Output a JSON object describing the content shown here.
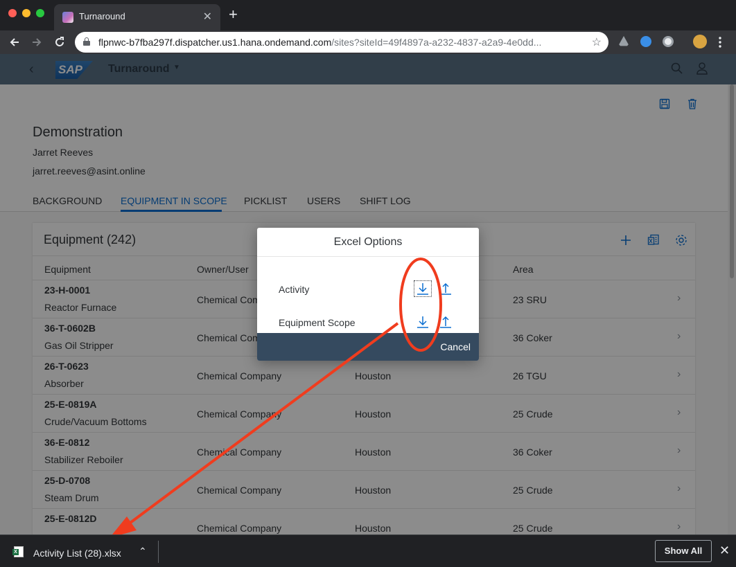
{
  "browser": {
    "tab_title": "Turnaround",
    "tab_close": "✕",
    "new_tab": "+",
    "url_host": "flpnwc-b7fba297f.dispatcher.us1.hana.ondemand.com",
    "url_path": "/sites?siteId=49f4897a-a232-4837-a2a9-4e0dd...",
    "star": "☆"
  },
  "shell": {
    "logo": "SAP",
    "title": "Turnaround",
    "caret": "▼",
    "back": "‹"
  },
  "object": {
    "title": "Demonstration",
    "user": "Jarret Reeves",
    "email": "jarret.reeves@asint.online"
  },
  "tabs": [
    "BACKGROUND",
    "EQUIPMENT IN SCOPE",
    "PICKLIST",
    "USERS",
    "SHIFT LOG"
  ],
  "panel": {
    "title": "Equipment (242)",
    "columns": [
      "Equipment",
      "Owner/User",
      "Area"
    ],
    "rows": [
      {
        "tag": "23-H-0001",
        "desc": "Reactor Furnace",
        "owner": "Chemical Com",
        "location": "",
        "area": "23 SRU"
      },
      {
        "tag": "36-T-0602B",
        "desc": "Gas Oil Stripper",
        "owner": "Chemical Com",
        "location": "",
        "area": "36 Coker"
      },
      {
        "tag": "26-T-0623",
        "desc": "Absorber",
        "owner": "Chemical Company",
        "location": "Houston",
        "area": "26 TGU"
      },
      {
        "tag": "25-E-0819A",
        "desc": "Crude/Vacuum Bottoms",
        "owner": "Chemical Company",
        "location": "Houston",
        "area": "25 Crude"
      },
      {
        "tag": "36-E-0812",
        "desc": "Stabilizer Reboiler",
        "owner": "Chemical Company",
        "location": "Houston",
        "area": "36 Coker"
      },
      {
        "tag": "25-D-0708",
        "desc": "Steam Drum",
        "owner": "Chemical Company",
        "location": "Houston",
        "area": "25 Crude"
      },
      {
        "tag": "25-E-0812D",
        "desc": "",
        "owner": "Chemical Company",
        "location": "Houston",
        "area": "25 Crude"
      }
    ],
    "chevron": "›"
  },
  "dialog": {
    "title": "Excel Options",
    "items": [
      {
        "label": "Activity"
      },
      {
        "label": "Equipment Scope"
      }
    ],
    "cancel": "Cancel"
  },
  "download": {
    "filename": "Activity List (28).xlsx",
    "caret": "⌃",
    "show_all": "Show All",
    "close": "✕"
  },
  "colors": {
    "accent": "#0a6ed1",
    "shell": "#5a7185",
    "annotation": "#f03c1e",
    "dialog_footer": "#354a5f"
  }
}
